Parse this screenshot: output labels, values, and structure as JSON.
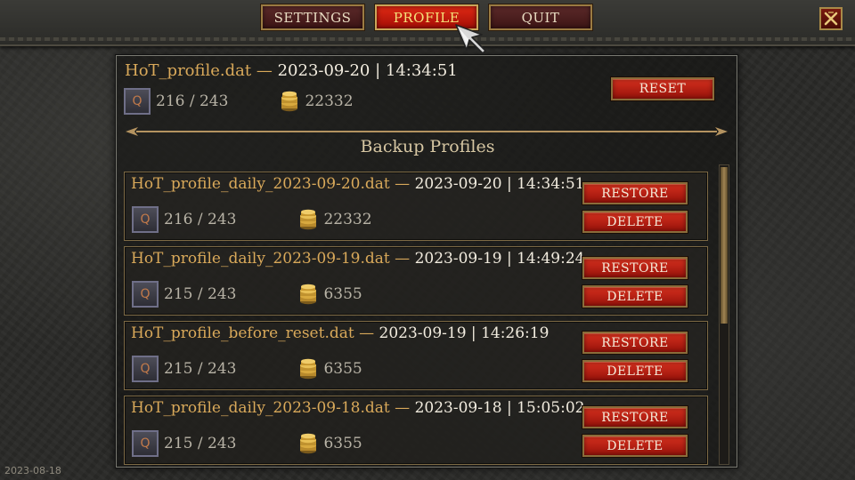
{
  "nav": {
    "settings": "SETTINGS",
    "profile": "PROFILE",
    "quit": "QUIT",
    "active": "profile",
    "close_icon": "close-x-icon"
  },
  "current_profile": {
    "filename": "HoT_profile.dat",
    "separator": " — ",
    "timestamp": "2023-09-20 | 14:34:51",
    "quests": "216 / 243",
    "gold": "22332",
    "reset_label": "RESET"
  },
  "backup_section": {
    "title": "Backup Profiles"
  },
  "backups": [
    {
      "filename": "HoT_profile_daily_2023-09-20.dat",
      "separator": " — ",
      "timestamp": "2023-09-20 | 14:34:51",
      "quests": "216 / 243",
      "gold": "22332",
      "restore_label": "RESTORE",
      "delete_label": "DELETE"
    },
    {
      "filename": "HoT_profile_daily_2023-09-19.dat",
      "separator": " — ",
      "timestamp": "2023-09-19 | 14:49:24",
      "quests": "215 / 243",
      "gold": "6355",
      "restore_label": "RESTORE",
      "delete_label": "DELETE"
    },
    {
      "filename": "HoT_profile_before_reset.dat",
      "separator": " — ",
      "timestamp": "2023-09-19 | 14:26:19",
      "quests": "215 / 243",
      "gold": "6355",
      "restore_label": "RESTORE",
      "delete_label": "DELETE"
    },
    {
      "filename": "HoT_profile_daily_2023-09-18.dat",
      "separator": " — ",
      "timestamp": "2023-09-18 | 15:05:02",
      "quests": "215 / 243",
      "gold": "6355",
      "restore_label": "RESTORE",
      "delete_label": "DELETE"
    }
  ],
  "icons": {
    "quest": "Q",
    "gold": "gold-coins-icon"
  },
  "colors": {
    "accent_red": "#d5301e",
    "gold_text": "#d9a95a",
    "active_text": "#f5e27a"
  },
  "version": "2023-08-18"
}
